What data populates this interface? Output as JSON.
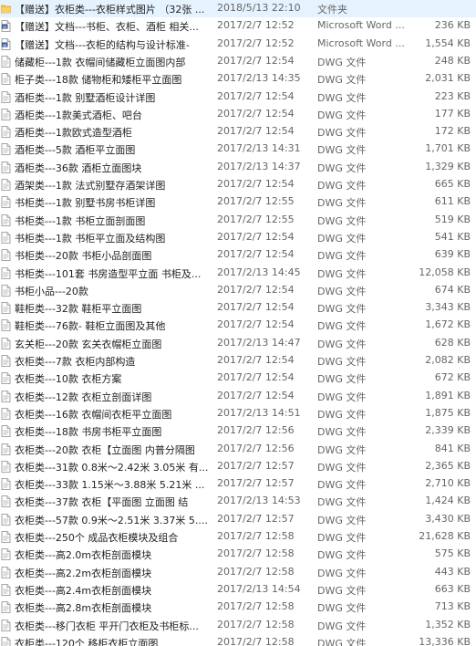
{
  "icons": {
    "folder": "folder-icon",
    "word": "word-document-icon",
    "dwg": "dwg-file-icon"
  },
  "files": [
    {
      "icon": "folder",
      "name": "【赠送】衣柜类---衣柜样式图片 （32张 ...",
      "date": "2018/5/13 22:10",
      "type": "文件夹",
      "size": ""
    },
    {
      "icon": "word",
      "name": "【赠送】文档---书柜、衣柜、酒柜 相关...",
      "date": "2017/2/7 12:52",
      "type": "Microsoft Word ...",
      "size": "236 KB"
    },
    {
      "icon": "word",
      "name": "【赠送】文档---衣柜的结构与设计标准-",
      "date": "2017/2/7 12:52",
      "type": "Microsoft Word ...",
      "size": "1,554 KB"
    },
    {
      "icon": "dwg",
      "name": "储藏柜---1款 衣帽间储藏柜立面图内部",
      "date": "2017/2/7 12:54",
      "type": "DWG 文件",
      "size": "248 KB"
    },
    {
      "icon": "dwg",
      "name": "柜子类---18款 储物柜和矮柜平立面图",
      "date": "2017/2/13 14:35",
      "type": "DWG 文件",
      "size": "2,031 KB"
    },
    {
      "icon": "dwg",
      "name": "酒柜类---1款 别墅酒柜设计详图",
      "date": "2017/2/7 12:54",
      "type": "DWG 文件",
      "size": "223 KB"
    },
    {
      "icon": "dwg",
      "name": "酒柜类---1款美式酒柜、吧台",
      "date": "2017/2/7 12:54",
      "type": "DWG 文件",
      "size": "177 KB"
    },
    {
      "icon": "dwg",
      "name": "酒柜类---1款欧式造型酒柜",
      "date": "2017/2/7 12:54",
      "type": "DWG 文件",
      "size": "172 KB"
    },
    {
      "icon": "dwg",
      "name": "酒柜类---5款 酒柜平立面图",
      "date": "2017/2/13 14:31",
      "type": "DWG 文件",
      "size": "1,701 KB"
    },
    {
      "icon": "dwg",
      "name": "酒柜类---36款 酒柜立面图块",
      "date": "2017/2/13 14:37",
      "type": "DWG 文件",
      "size": "1,329 KB"
    },
    {
      "icon": "dwg",
      "name": "酒架类---1款 法式别墅存酒架详图",
      "date": "2017/2/7 12:54",
      "type": "DWG 文件",
      "size": "665 KB"
    },
    {
      "icon": "dwg",
      "name": "书柜类---1款 别墅书房书柜详图",
      "date": "2017/2/7 12:55",
      "type": "DWG 文件",
      "size": "611 KB"
    },
    {
      "icon": "dwg",
      "name": "书柜类---1款 书柜立面剖面图",
      "date": "2017/2/7 12:55",
      "type": "DWG 文件",
      "size": "519 KB"
    },
    {
      "icon": "dwg",
      "name": "书柜类---1款 书柜平立面及结构图",
      "date": "2017/2/7 12:54",
      "type": "DWG 文件",
      "size": "541 KB"
    },
    {
      "icon": "dwg",
      "name": "书柜类---20款 书柜小品剖面图",
      "date": "2017/2/7 12:54",
      "type": "DWG 文件",
      "size": "639 KB"
    },
    {
      "icon": "dwg",
      "name": "书柜类---101套 书房造型平立面 书柜及...",
      "date": "2017/2/13 14:45",
      "type": "DWG 文件",
      "size": "12,058 KB"
    },
    {
      "icon": "dwg",
      "name": "书柜小品---20款",
      "date": "2017/2/7 12:54",
      "type": "DWG 文件",
      "size": "674 KB"
    },
    {
      "icon": "dwg",
      "name": "鞋柜类---32款 鞋柜平立面图",
      "date": "2017/2/7 12:54",
      "type": "DWG 文件",
      "size": "3,343 KB"
    },
    {
      "icon": "dwg",
      "name": "鞋柜类---76款- 鞋柜立面图及其他",
      "date": "2017/2/7 12:54",
      "type": "DWG 文件",
      "size": "1,672 KB"
    },
    {
      "icon": "dwg",
      "name": "玄关柜---20款 玄关衣帽柜立面图",
      "date": "2017/2/13 14:47",
      "type": "DWG 文件",
      "size": "628 KB"
    },
    {
      "icon": "dwg",
      "name": "衣柜类---7款 衣柜内部构造",
      "date": "2017/2/7 12:54",
      "type": "DWG 文件",
      "size": "2,082 KB"
    },
    {
      "icon": "dwg",
      "name": "衣柜类---10款 衣柜方案",
      "date": "2017/2/7 12:54",
      "type": "DWG 文件",
      "size": "672 KB"
    },
    {
      "icon": "dwg",
      "name": "衣柜类---12款 衣柜立剖面详图",
      "date": "2017/2/7 12:54",
      "type": "DWG 文件",
      "size": "1,891 KB"
    },
    {
      "icon": "dwg",
      "name": "衣柜类---16款 衣帽间衣柜平立面图",
      "date": "2017/2/13 14:51",
      "type": "DWG 文件",
      "size": "1,875 KB"
    },
    {
      "icon": "dwg",
      "name": "衣柜类---18款 书房书柜平立面图",
      "date": "2017/2/7 12:56",
      "type": "DWG 文件",
      "size": "2,339 KB"
    },
    {
      "icon": "dwg",
      "name": "衣柜类---20款 衣柜【立面图 内普分隔图",
      "date": "2017/2/7 12:56",
      "type": "DWG 文件",
      "size": "841 KB"
    },
    {
      "icon": "dwg",
      "name": "衣柜类---31款 0.8米～2.42米 3.05米 有...",
      "date": "2017/2/7 12:57",
      "type": "DWG 文件",
      "size": "2,365 KB"
    },
    {
      "icon": "dwg",
      "name": "衣柜类---33款 1.15米～3.88米 5.21米 ...",
      "date": "2017/2/7 12:57",
      "type": "DWG 文件",
      "size": "2,710 KB"
    },
    {
      "icon": "dwg",
      "name": "衣柜类---37款 衣柜【平面图 立面图 结",
      "date": "2017/2/13 14:53",
      "type": "DWG 文件",
      "size": "1,424 KB"
    },
    {
      "icon": "dwg",
      "name": "衣柜类---57款 0.9米～2.51米 3.37米 5....",
      "date": "2017/2/7 12:57",
      "type": "DWG 文件",
      "size": "3,430 KB"
    },
    {
      "icon": "dwg",
      "name": "衣柜类---250个 成品衣柜模块及组合",
      "date": "2017/2/7 12:58",
      "type": "DWG 文件",
      "size": "21,628 KB"
    },
    {
      "icon": "dwg",
      "name": "衣柜类---高2.0m衣柜剖面模块",
      "date": "2017/2/7 12:58",
      "type": "DWG 文件",
      "size": "575 KB"
    },
    {
      "icon": "dwg",
      "name": "衣柜类---高2.2m衣柜剖面模块",
      "date": "2017/2/7 12:58",
      "type": "DWG 文件",
      "size": "443 KB"
    },
    {
      "icon": "dwg",
      "name": "衣柜类---高2.4m衣柜剖面模块",
      "date": "2017/2/13 14:54",
      "type": "DWG 文件",
      "size": "663 KB"
    },
    {
      "icon": "dwg",
      "name": "衣柜类---高2.8m衣柜剖面模块",
      "date": "2017/2/7 12:58",
      "type": "DWG 文件",
      "size": "713 KB"
    },
    {
      "icon": "dwg",
      "name": "衣柜类---移门衣柜 平开门衣柜及书柜标...",
      "date": "2017/2/7 12:58",
      "type": "DWG 文件",
      "size": "1,352 KB"
    },
    {
      "icon": "dwg",
      "name": "衣柜类---120个 移柜衣柜立面图",
      "date": "2017/2/7 12:58",
      "type": "DWG 文件",
      "size": "13,336 KB"
    }
  ]
}
